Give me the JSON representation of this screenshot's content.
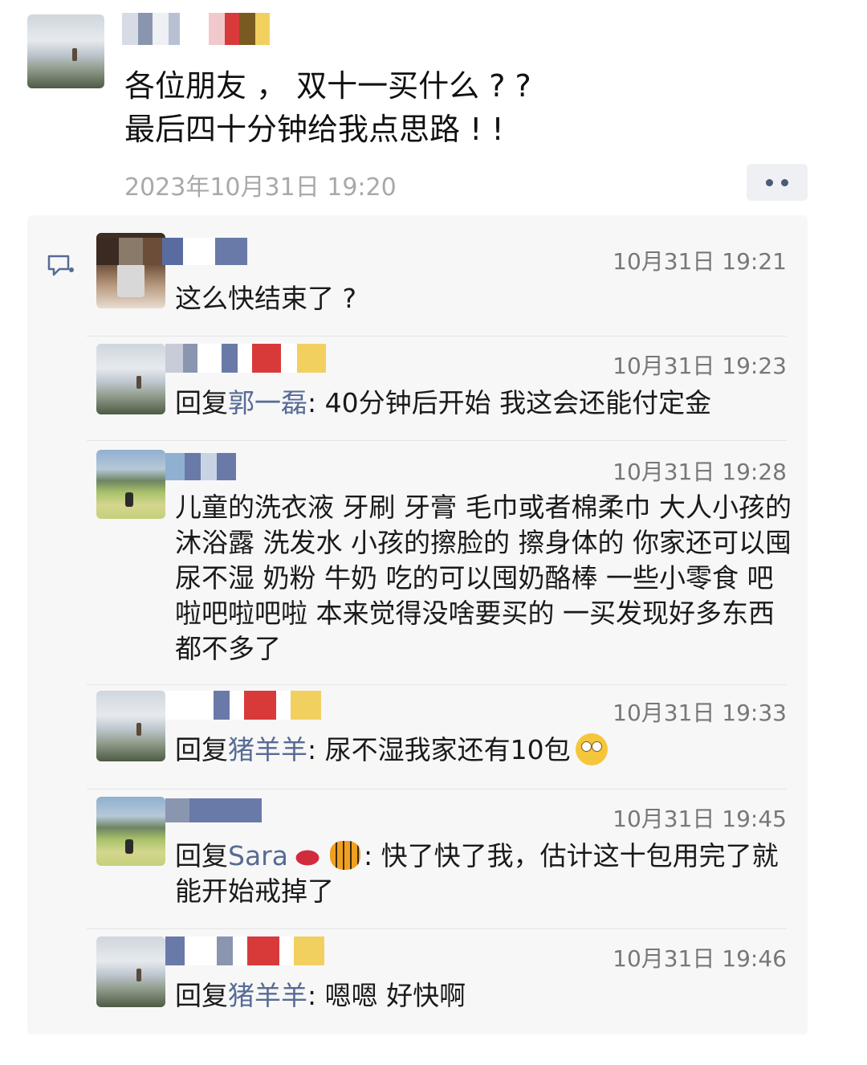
{
  "post": {
    "text_line1": "各位朋友 ， 双十一买什么 ? ?",
    "text_line2": "最后四十分钟给我点思路 ! !",
    "timestamp": "2023年10月31日 19:20"
  },
  "more_button": {
    "icon": "more-dots-icon"
  },
  "comments_icon": "comment-bubble-icon",
  "comments": [
    {
      "time": "10月31日 19:21",
      "text": "这么快结束了 ?"
    },
    {
      "time": "10月31日 19:23",
      "reply_prefix": "回复",
      "reply_to": "郭一磊",
      "text": ": 40分钟后开始 我这会还能付定金"
    },
    {
      "time": "10月31日 19:28",
      "text": "儿童的洗衣液 牙刷 牙膏 毛巾或者棉柔巾 大人小孩的沐浴露 洗发水 小孩的擦脸的 擦身体的 你家还可以囤尿不湿 奶粉 牛奶 吃的可以囤奶酪棒 一些小零食 吧啦吧啦吧啦 本来觉得没啥要买的 一买发现好多东西都不多了"
    },
    {
      "time": "10月31日 19:33",
      "reply_prefix": "回复",
      "reply_to": "猪羊羊",
      "text": ": 尿不湿我家还有10包"
    },
    {
      "time": "10月31日 19:45",
      "reply_prefix": "回复",
      "reply_to": "Sara",
      "text": ": 快了快了我，估计这十包用完了就能开始戒掉了"
    },
    {
      "time": "10月31日 19:46",
      "reply_prefix": "回复",
      "reply_to": "猪羊羊",
      "text": ": 嗯嗯 好快啊"
    }
  ],
  "colors": {
    "link": "#576b95",
    "panel": "#f7f7f7",
    "timestamp": "#a9a9a9"
  }
}
